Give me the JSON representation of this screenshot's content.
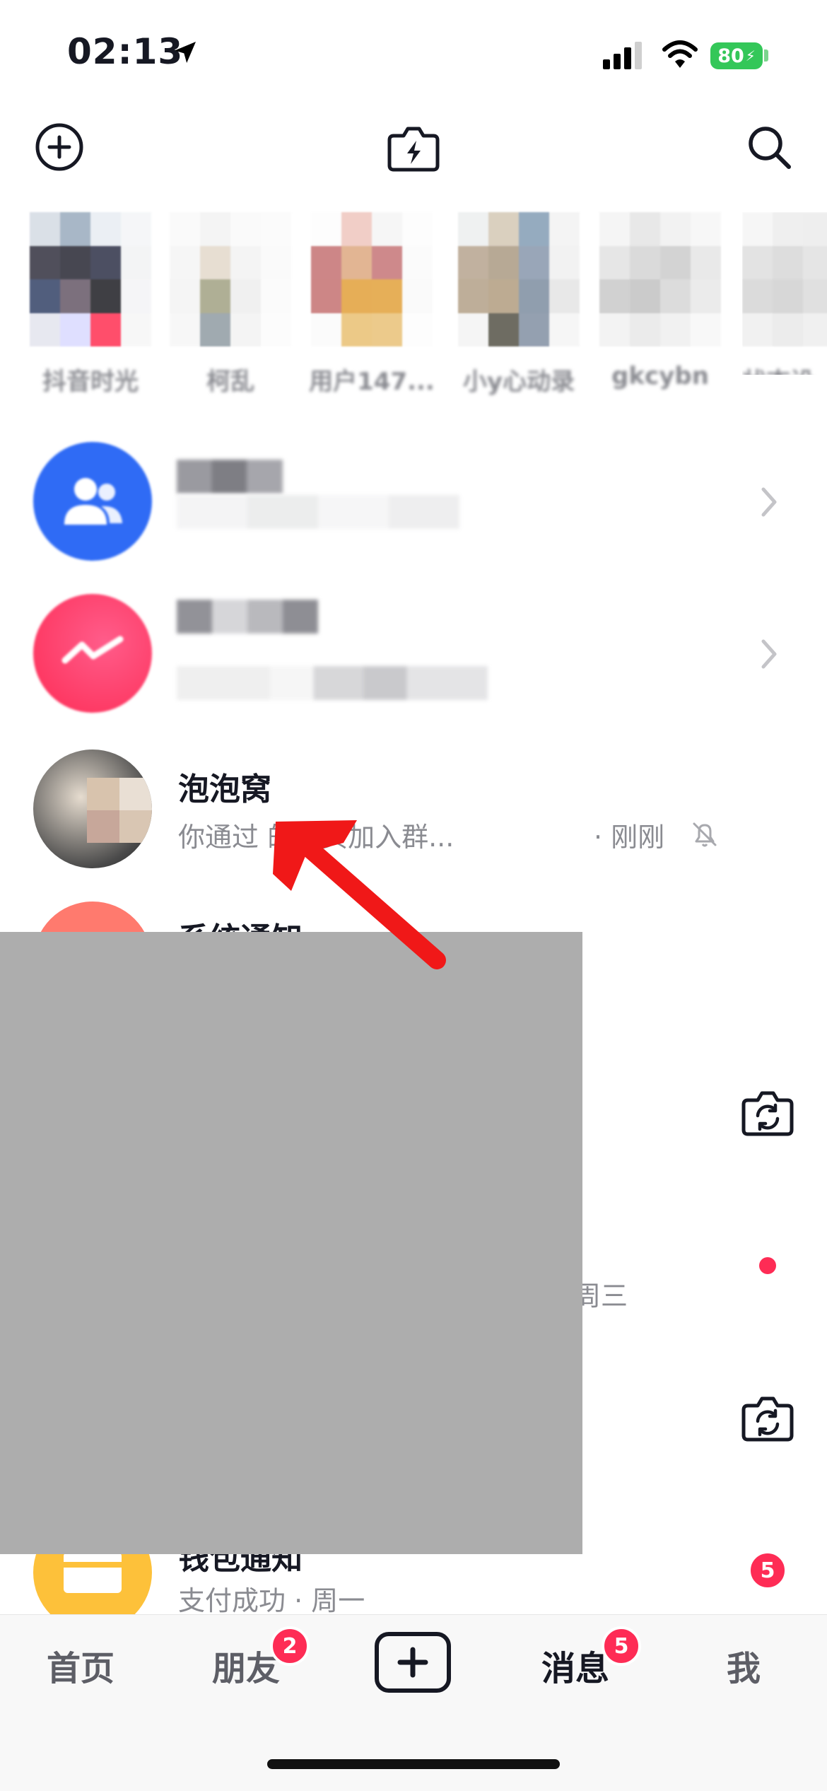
{
  "status_bar": {
    "time": "02:13",
    "battery": "80"
  },
  "header": {
    "add_icon": "plus-circle-icon",
    "flash_icon": "flash-camera-icon",
    "search_icon": "search-icon"
  },
  "stories": [
    {
      "name": "抖音时光"
    },
    {
      "name": "柯乱"
    },
    {
      "name": "用户147..."
    },
    {
      "name": "小y心动录"
    },
    {
      "name": "gkcybn"
    },
    {
      "name": "状态设"
    }
  ],
  "conversations": [
    {
      "title": "泡泡窝",
      "subtitle": "你通过 的主页加入群...",
      "time": "· 刚刚"
    },
    {
      "title": "系统通知"
    },
    {
      "time": "周三"
    },
    {
      "title": "钱包通知",
      "subtitle": "支付成功 · 周一",
      "badge": "5"
    }
  ],
  "tabbar": {
    "home": "首页",
    "friends": "朋友",
    "friends_badge": "2",
    "messages": "消息",
    "messages_badge": "5",
    "me": "我"
  },
  "colors": {
    "accent": "#fe2c55",
    "group_blue": "#2f6bf5",
    "interact_pink": "#fe2c55",
    "wallet_yellow": "#fdc13a"
  }
}
